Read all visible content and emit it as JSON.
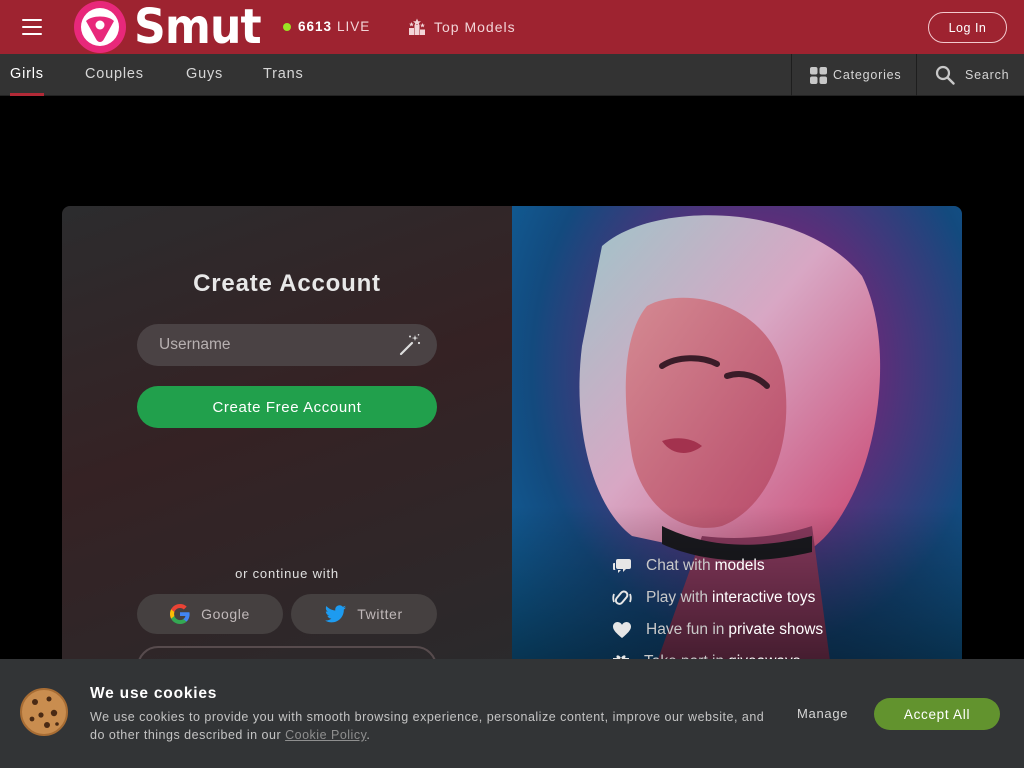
{
  "header": {
    "logo_text": "Smut",
    "live_count": "6613",
    "live_label": "LIVE",
    "top_models_label": "Top Models",
    "login_label": "Log In"
  },
  "subnav": {
    "tabs": [
      {
        "label": "Girls",
        "active": true
      },
      {
        "label": "Couples",
        "active": false
      },
      {
        "label": "Guys",
        "active": false
      },
      {
        "label": "Trans",
        "active": false
      }
    ],
    "categories_label": "Categories",
    "search_label": "Search"
  },
  "signup": {
    "title": "Create Account",
    "username_placeholder": "Username",
    "create_button": "Create Free Account",
    "continue_with": "or continue with",
    "google_label": "Google",
    "twitter_label": "Twitter"
  },
  "features": [
    {
      "prefix": "Chat with",
      "highlight": "models",
      "icon": "chat-icon"
    },
    {
      "prefix": "Play with",
      "highlight": "interactive toys",
      "icon": "vibration-icon"
    },
    {
      "prefix": "Have fun in",
      "highlight": "private shows",
      "icon": "heart-icon"
    },
    {
      "prefix": "Take part in",
      "highlight": "giveaways",
      "icon": "gift-icon"
    }
  ],
  "cookie": {
    "title": "We use cookies",
    "text": "We use cookies to provide you with smooth browsing experience, personalize content, improve our website, and do other things described in our",
    "policy_link": "Cookie Policy",
    "policy_suffix": ".",
    "manage_label": "Manage",
    "accept_label": "Accept All"
  },
  "colors": {
    "header_bg": "#9e2330",
    "subnav_bg": "#333333",
    "accent_green": "#21a04c",
    "live_dot": "#9be224",
    "accept_green": "#62932e"
  }
}
